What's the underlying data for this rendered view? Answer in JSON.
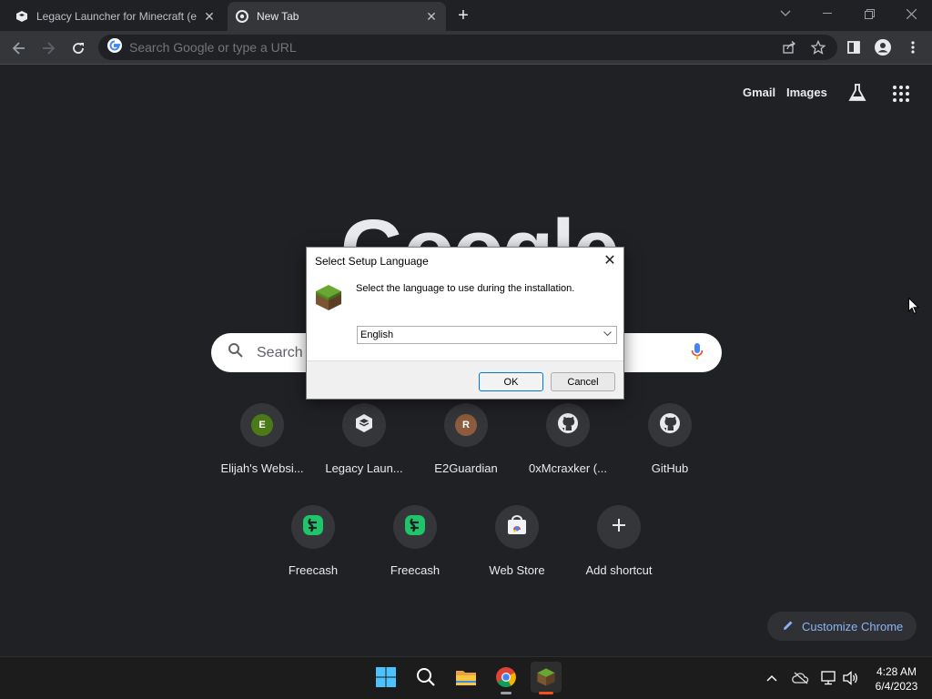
{
  "browser": {
    "tabs": [
      {
        "title": "Legacy Launcher for Minecraft (e",
        "icon": "hexagon-icon"
      },
      {
        "title": "New Tab",
        "icon": "chrome-icon"
      }
    ],
    "omnibox_placeholder": "Search Google or type a URL"
  },
  "ntp": {
    "top_links": [
      "Gmail",
      "Images"
    ],
    "logo_text": "Google",
    "search_placeholder": "Search",
    "shortcuts": [
      {
        "label": "Elijah's Websi...",
        "icon": "letter",
        "letter": "E",
        "color": "#4d7a19"
      },
      {
        "label": "Legacy Laun...",
        "icon": "hexagon-icon"
      },
      {
        "label": "E2Guardian",
        "icon": "letter",
        "letter": "R",
        "color": "#8d5b3e"
      },
      {
        "label": "0xMcraxker (...",
        "icon": "github-icon"
      },
      {
        "label": "GitHub",
        "icon": "github-icon"
      },
      {
        "label": "Freecash",
        "icon": "freecash-icon"
      },
      {
        "label": "Freecash",
        "icon": "freecash-icon"
      },
      {
        "label": "Web Store",
        "icon": "webstore-icon"
      },
      {
        "label": "Add shortcut",
        "icon": "plus-icon"
      }
    ],
    "customize_label": "Customize Chrome"
  },
  "dialog": {
    "title": "Select Setup Language",
    "message": "Select the language to use during the installation.",
    "selected_language": "English",
    "ok_label": "OK",
    "cancel_label": "Cancel"
  },
  "taskbar": {
    "time": "4:28 AM",
    "date": "6/4/2023"
  },
  "colors": {
    "background": "#202124",
    "toolbar": "#35363a",
    "accent": "#8ab4f8"
  }
}
